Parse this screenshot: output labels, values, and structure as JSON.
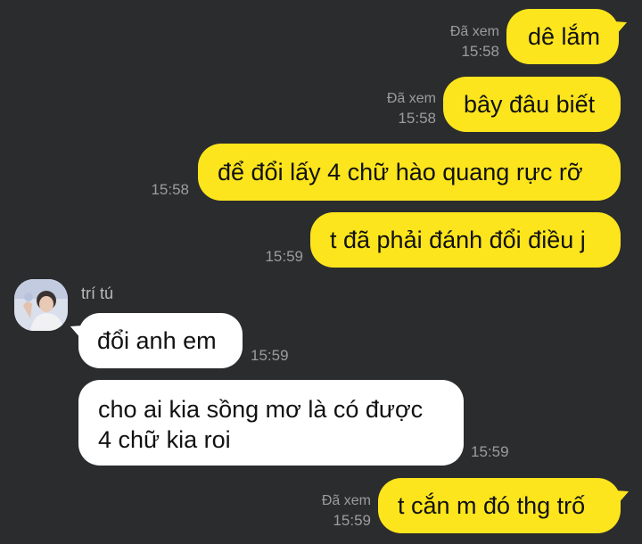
{
  "messages": [
    {
      "text": "dê lắm",
      "seen": "Đã xem",
      "time": "15:58"
    },
    {
      "text": "bây đâu biết",
      "seen": "Đã xem",
      "time": "15:58"
    },
    {
      "text": "để đổi lấy 4 chữ hào quang rực rỡ",
      "time": "15:58"
    },
    {
      "text": "t đã phải đánh đổi điều j",
      "time": "15:59"
    },
    {
      "sender": "trí tú",
      "text": "đổi anh em",
      "time": "15:59"
    },
    {
      "text_line1": "cho ai kia sồng mơ là có được",
      "text_line2": "4 chữ kia roi",
      "time": "15:59"
    },
    {
      "text": "t cắn m đó thg trố",
      "seen": "Đã xem",
      "time": "15:59"
    }
  ],
  "colors": {
    "background": "#2b2c2e",
    "outgoing": "#fce51c",
    "incoming": "#ffffff",
    "meta": "#9b9c9e"
  },
  "icons": {
    "avatar": "user-avatar-photo"
  }
}
